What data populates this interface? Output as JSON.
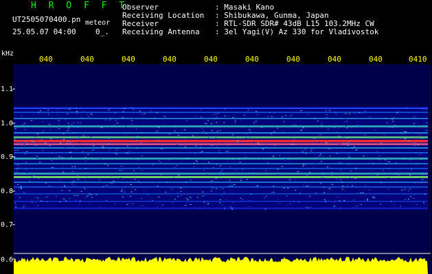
{
  "header": {
    "title": "H R O F F T",
    "filename": "UT2505070400.pn",
    "type_label": "meteor",
    "datetime": "25.05.07 04:00",
    "sn_label": "0_.",
    "fields": [
      {
        "label": "Observer",
        "value": ": Masaki Kano"
      },
      {
        "label": "Receiving Location",
        "value": ": Shibukawa, Gunma, Japan"
      },
      {
        "label": "Receiver",
        "value": ": RTL-SDR SDR# 43dB L15 103.2MHz CW"
      },
      {
        "label": "Receiving Antenna",
        "value": ": 3el Yagi(V) Az 330 for Vladivostok"
      }
    ]
  },
  "colors": {
    "text": "#ffffff",
    "title": "#00ff00",
    "accent": "#ffff00",
    "background": "#000000",
    "spectrogram_base": "#00007a"
  },
  "axis": {
    "y_unit": "kHz",
    "y_ticks": [
      "1.1",
      "1.0",
      "0.9",
      "0.8",
      "0.7",
      "0.6"
    ],
    "x_ticks": [
      "040",
      "040",
      "040",
      "040",
      "040",
      "040",
      "040",
      "040",
      "040",
      "0410"
    ]
  }
}
